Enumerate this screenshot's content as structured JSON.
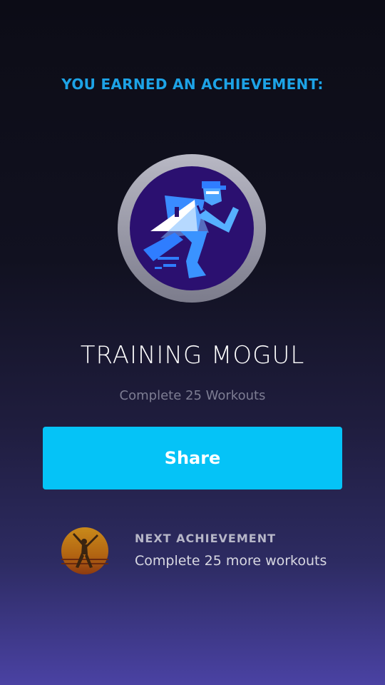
{
  "header": {
    "label": "YOU EARNED AN ACHIEVEMENT:"
  },
  "achievement": {
    "icon": "running-man-badge-icon",
    "title": "TRAINING MOGUL",
    "description": "Complete 25 Workouts"
  },
  "share": {
    "label": "Share"
  },
  "next": {
    "icon": "jumping-figure-badge-icon",
    "label": "NEXT ACHIEVEMENT",
    "description": "Complete 25 more workouts"
  },
  "colors": {
    "accent": "#1da3e6",
    "button": "#05c3f7",
    "badge_ring": "#9a9aa8",
    "badge_fill": "#2b1070"
  }
}
